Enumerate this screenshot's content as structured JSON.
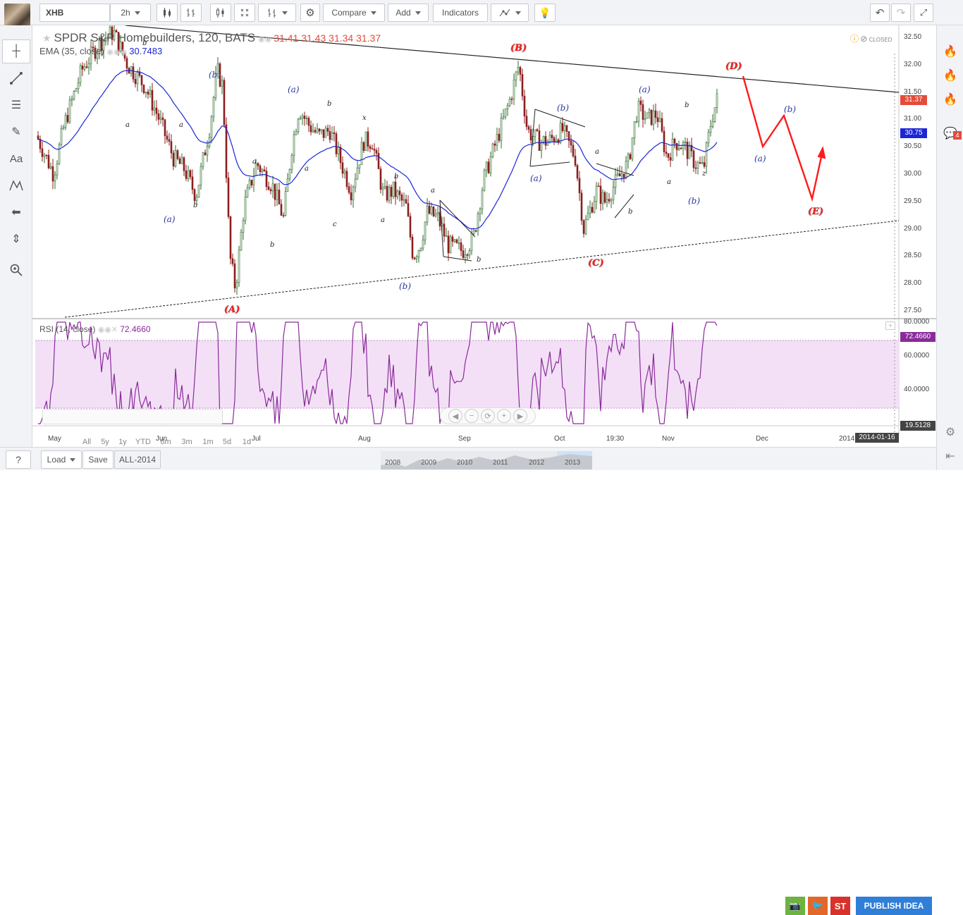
{
  "toolbar": {
    "symbol": "XHB",
    "interval": "2h",
    "compare_label": "Compare",
    "add_label": "Add",
    "indicators_label": "Indicators"
  },
  "legend": {
    "title": "SPDR S&P Homebuilders, 120, BATS",
    "open": "31.41",
    "high": "31.43",
    "low": "31.34",
    "close": "31.37",
    "ema_label": "EMA (35, close)",
    "ema_value": "30.7483",
    "market_status": "CLOSED"
  },
  "rsi_legend": {
    "label": "RSI (14, close)",
    "value": "72.4660"
  },
  "price_axis": {
    "ticks": [
      "32.50",
      "32.00",
      "31.50",
      "31.00",
      "30.50",
      "30.00",
      "29.50",
      "29.00",
      "28.50",
      "28.00",
      "27.50"
    ],
    "last_price": "31.37",
    "ema_price": "30.75"
  },
  "rsi_axis": {
    "ticks": [
      "80.0000",
      "60.0000",
      "40.0000"
    ],
    "last_value": "72.4660",
    "min_value": "19.5128"
  },
  "time_axis": {
    "labels": [
      "May",
      "Jun",
      "Jul",
      "Aug",
      "Sep",
      "Oct",
      "19:30",
      "Nov",
      "Dec",
      "2014"
    ],
    "cursor_date": "2014-01-16"
  },
  "ranges": [
    "All",
    "5y",
    "1y",
    "YTD",
    "6m",
    "3m",
    "1m",
    "5d",
    "1d"
  ],
  "bottom": {
    "load_label": "Load",
    "save_label": "Save",
    "layout_name": "ALL-2014",
    "years": [
      "2008",
      "2009",
      "2010",
      "2011",
      "2012",
      "2013"
    ],
    "publish_label": "PUBLISH IDEA",
    "stocktwits_label": "ST"
  },
  "right_panel": {
    "alerts_badge": "4"
  },
  "wave_labels": {
    "A": "(A)",
    "B": "(B)",
    "C": "(C)",
    "D": "(D)",
    "E": "(E)",
    "a_paren": "(a)",
    "b_paren": "(b)",
    "a": "a",
    "b": "b",
    "c": "c",
    "x": "x",
    "z": "z"
  },
  "colors": {
    "accent_blue": "#1f5bbf",
    "ema_line": "#1b27d6",
    "rsi_line": "#8a2b9a",
    "rsi_band": "#f3e0f7",
    "projection_red": "#ff0000",
    "price_red": "#e34b3b",
    "candle_up": "#2f6b2f",
    "candle_down": "#8b1e1e",
    "publish_blue": "#2f7ed8"
  }
}
